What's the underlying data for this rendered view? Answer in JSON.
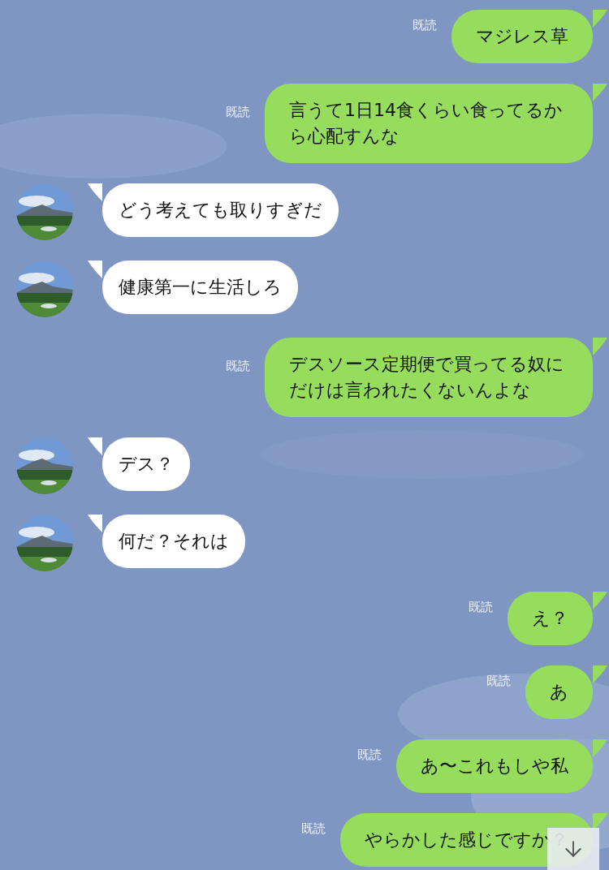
{
  "messages": [
    {
      "kind": "sent",
      "text": "マジレス草",
      "read": "既読"
    },
    {
      "kind": "sent",
      "text": "言うて1日14食くらい食ってるから心配すんな",
      "read": "既読"
    },
    {
      "kind": "received",
      "text": "どう考えても取りすぎだ"
    },
    {
      "kind": "received",
      "text": "健康第一に生活しろ"
    },
    {
      "kind": "sent",
      "text": "デスソース定期便で買ってる奴にだけは言われたくないんよな",
      "read": "既読"
    },
    {
      "kind": "received",
      "text": "デス？"
    },
    {
      "kind": "received",
      "text": "何だ？それは"
    },
    {
      "kind": "sent",
      "text": "え？",
      "read": "既読"
    },
    {
      "kind": "sent",
      "text": "あ",
      "read": "既読"
    },
    {
      "kind": "sent",
      "text": "あ〜これもしや私",
      "read": "既読"
    },
    {
      "kind": "sent",
      "text": "やらかした感じですか？",
      "read": "既読"
    }
  ]
}
